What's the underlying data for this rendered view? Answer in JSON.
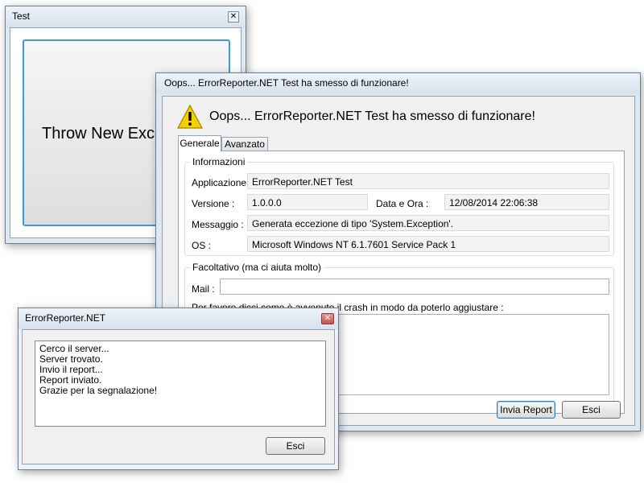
{
  "test_window": {
    "title": "Test",
    "big_button_label": "Throw New Exception"
  },
  "error_dialog": {
    "title": "Oops... ErrorReporter.NET Test ha smesso di funzionare!",
    "header": "Oops... ErrorReporter.NET Test ha smesso di funzionare!",
    "tabs": [
      {
        "label": "Generale"
      },
      {
        "label": "Avanzato"
      }
    ],
    "info_group": {
      "title": "Informazioni",
      "application_label": "Applicazione :",
      "application_value": "ErrorReporter.NET Test",
      "version_label": "Versione :",
      "version_value": "1.0.0.0",
      "datetime_label": "Data e Ora :",
      "datetime_value": "12/08/2014 22:06:38",
      "message_label": "Messaggio :",
      "message_value": "Generata eccezione di tipo 'System.Exception'.",
      "os_label": "OS :",
      "os_value": "Microsoft Windows NT 6.1.7601 Service Pack 1"
    },
    "optional_group": {
      "title": "Facoltativo (ma ci aiuta molto)",
      "mail_label": "Mail :",
      "mail_value": "",
      "description_label": "Per favore dicci come è avvenuto il crash in modo da poterlo aggiustare :",
      "description_value": ""
    },
    "send_button": "Invia Report",
    "exit_button": "Esci"
  },
  "progress_dialog": {
    "title": "ErrorReporter.NET",
    "log_lines": [
      "Cerco il server...",
      "Server trovato.",
      "Invio il report...",
      "Report inviato.",
      "Grazie per la segnalazione!"
    ],
    "exit_button": "Esci"
  },
  "colors": {
    "accent_blue": "#3c7fb1",
    "close_red": "#c75050",
    "warning_yellow": "#f5d000"
  }
}
